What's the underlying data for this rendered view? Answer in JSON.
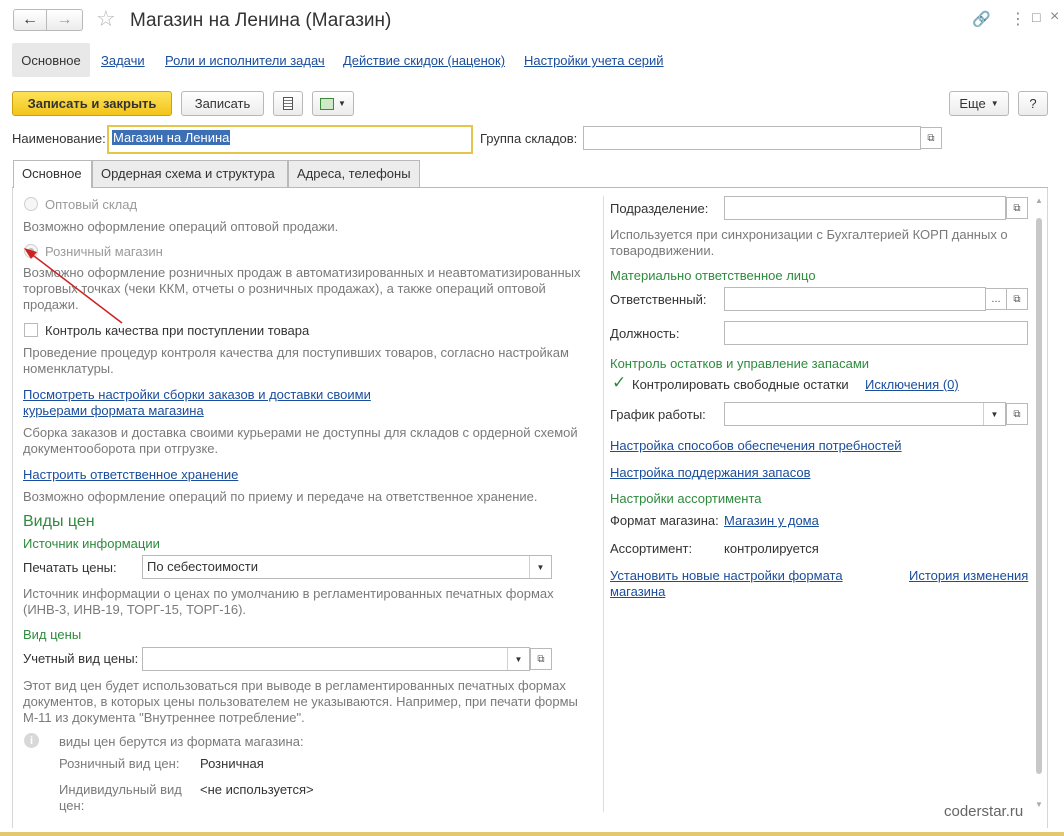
{
  "header": {
    "title": "Магазин на Ленина (Магазин)",
    "nav_tabs": [
      "Основное",
      "Задачи",
      "Роли и исполнители задач",
      "Действие скидок (наценок)",
      "Настройки учета серий"
    ]
  },
  "toolbar": {
    "save_close": "Записать и закрыть",
    "save": "Записать",
    "more": "Еще",
    "help": "?"
  },
  "top_fields": {
    "name_label": "Наименование:",
    "name_value": "Магазин на Ленина",
    "group_label": "Группа складов:",
    "group_value": ""
  },
  "tabs": [
    "Основное",
    "Ордерная схема и структура",
    "Адреса, телефоны"
  ],
  "left": {
    "wholesale_label": "Оптовый склад",
    "wholesale_desc": "Возможно оформление операций оптовой продажи.",
    "retail_label": "Розничный магазин",
    "retail_desc": "Возможно оформление розничных продаж в автоматизированных и неавтоматизированных торговых точках (чеки ККМ, отчеты о розничных продажах), а также операций оптовой продажи.",
    "quality_label": "Контроль качества при поступлении товара",
    "quality_desc": "Проведение процедур контроля качества для поступивших товаров, согласно настройкам номенклатуры.",
    "assembly_link": "Посмотреть настройки сборки заказов и доставки своими курьерами формата магазина",
    "assembly_desc": "Сборка заказов и доставка своими курьерами не доступны для складов с ордерной схемой документооборота при отгрузке.",
    "storage_link": "Настроить ответственное хранение",
    "storage_desc": "Возможно оформление операций по приему и передаче на ответственное хранение.",
    "prices_heading": "Виды цен",
    "source_heading": "Источник информации",
    "print_prices_label": "Печатать цены:",
    "print_prices_value": "По себестоимости",
    "source_desc": "Источник информации о ценах по умолчанию в регламентированных печатных формах (ИНВ-3, ИНВ-19, ТОРГ-15, ТОРГ-16).",
    "price_type_heading": "Вид цены",
    "account_price_label": "Учетный вид цены:",
    "account_price_value": "",
    "account_price_desc": "Этот вид цен будет использоваться при выводе в регламентированных печатных формах документов, в которых цены пользователем не указываются. Например, при печати формы М-11 из документа \"Внутреннее потребление\".",
    "info_text": "виды цен берутся из формата магазина:",
    "retail_price_label": "Розничный вид цен:",
    "retail_price_value": "Розничная",
    "individual_price_label": "Индивидульный вид цен:",
    "individual_price_value": "<не используется>"
  },
  "right": {
    "division_label": "Подразделение:",
    "division_value": "",
    "division_desc": "Используется при синхронизации с Бухгалтерией КОРП данных о товародвижении.",
    "responsible_heading": "Материально ответственное лицо",
    "responsible_label": "Ответственный:",
    "responsible_value": "",
    "position_label": "Должность:",
    "position_value": "",
    "stock_heading": "Контроль остатков и управление запасами",
    "control_free_label": "Контролировать свободные остатки",
    "exceptions_link": "Исключения (0)",
    "schedule_label": "График работы:",
    "schedule_value": "",
    "supply_link": "Настройка способов обеспечения потребностей",
    "stock_link": "Настройка поддержания запасов",
    "assortment_heading": "Настройки ассортимента",
    "store_format_label": "Формат магазина:",
    "store_format_link": "Магазин у дома",
    "assortment_label": "Ассортимент:",
    "assortment_value": "контролируется",
    "new_settings_link": "Установить новые настройки формата магазина",
    "history_link": "История изменения"
  },
  "watermark": "coderstar.ru",
  "colors": {
    "accent_yellow": "#f3c41a",
    "link_blue": "#1a4d9c",
    "section_green": "#2e8b3d",
    "annotation_red": "#cc2222"
  }
}
